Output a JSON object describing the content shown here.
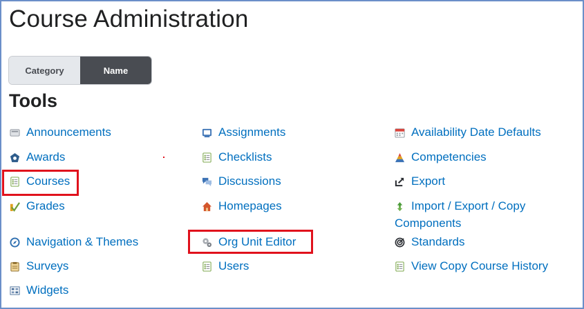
{
  "page": {
    "title": "Course Administration"
  },
  "view_toggle": {
    "options": [
      "Category",
      "Name"
    ],
    "selected": "Name"
  },
  "section": {
    "title": "Tools"
  },
  "tools": {
    "announcements": "Announcements",
    "awards": "Awards",
    "courses": "Courses",
    "grades": "Grades",
    "navigation_themes": "Navigation & Themes",
    "surveys": "Surveys",
    "widgets": "Widgets",
    "assignments": "Assignments",
    "checklists": "Checklists",
    "discussions": "Discussions",
    "homepages": "Homepages",
    "org_unit_editor": "Org Unit Editor",
    "users": "Users",
    "availability_date_defaults": "Availability Date Defaults",
    "competencies": "Competencies",
    "export": "Export",
    "import_export_copy": "Import / Export / Copy",
    "import_export_copy_cont": "Components",
    "standards": "Standards",
    "view_copy_course_history": "View Copy Course History"
  },
  "highlighted_tools": [
    "Courses",
    "Org Unit Editor"
  ],
  "colors": {
    "link": "#006fbf",
    "highlight": "#e0111c",
    "frame": "#6b8fc9"
  }
}
